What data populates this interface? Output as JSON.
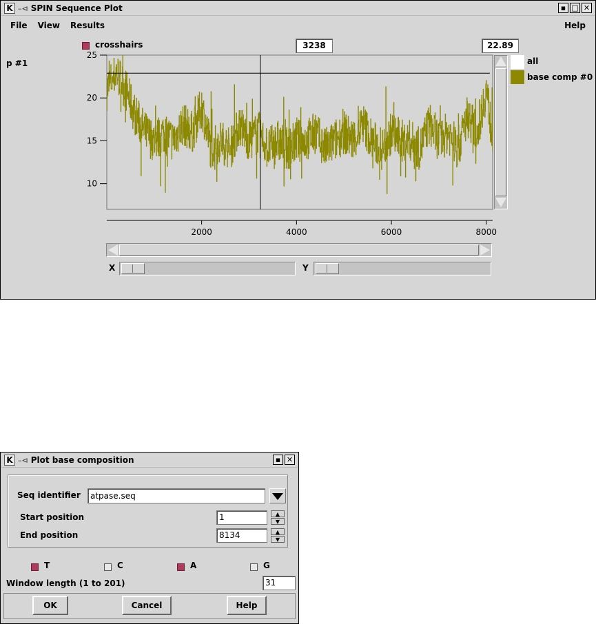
{
  "plot_window": {
    "title": "SPIN Sequence Plot",
    "menus": [
      "File",
      "View",
      "Results"
    ],
    "help_menu": "Help",
    "crosshairs_label": "crosshairs",
    "crosshairs_checked": true,
    "x_readout": "3238",
    "y_readout": "22.89",
    "plot_name": "p #1",
    "legend": [
      {
        "label": "all",
        "color": "#ffffff"
      },
      {
        "label": "base comp #0",
        "color": "#8c8800"
      }
    ],
    "x_zoom_label": "X",
    "y_zoom_label": "Y"
  },
  "chart_data": {
    "type": "line",
    "title": "",
    "xlabel": "",
    "ylabel": "",
    "xlim": [
      1,
      8134
    ],
    "ylim": [
      7,
      25
    ],
    "x_ticks": [
      "2000",
      "4000",
      "6000",
      "8000"
    ],
    "y_ticks": [
      "10",
      "15",
      "20",
      "25"
    ],
    "crosshair": {
      "x": 3238,
      "y": 22.89
    },
    "series": [
      {
        "name": "base comp #0",
        "color": "#8c8800",
        "x": [
          1,
          200,
          400,
          600,
          800,
          1000,
          1200,
          1400,
          1600,
          1800,
          2000,
          2200,
          2400,
          2600,
          2800,
          3000,
          3200,
          3400,
          3600,
          3800,
          4000,
          4200,
          4400,
          4600,
          4800,
          5000,
          5200,
          5400,
          5600,
          5800,
          6000,
          6200,
          6400,
          6600,
          6800,
          7000,
          7200,
          7400,
          7600,
          7800,
          8000,
          8134
        ],
        "values": [
          21,
          23,
          21,
          18,
          16,
          15,
          16,
          15,
          17,
          16,
          19,
          14,
          15,
          14,
          17,
          15,
          16,
          14,
          15,
          14,
          15,
          15,
          16,
          14,
          15,
          16,
          15,
          17,
          15,
          14,
          16,
          15,
          15,
          14,
          17,
          15,
          16,
          14,
          18,
          16,
          21,
          15
        ]
      }
    ]
  },
  "dialog": {
    "title": "Plot base composition",
    "seq_identifier_label": "Seq identifier",
    "seq_identifier_value": "atpase.seq",
    "start_label": "Start position",
    "start_value": "1",
    "end_label": "End position",
    "end_value": "8134",
    "bases": [
      {
        "label": "T",
        "checked": true
      },
      {
        "label": "C",
        "checked": false
      },
      {
        "label": "A",
        "checked": true
      },
      {
        "label": "G",
        "checked": false
      }
    ],
    "window_length_label": "Window length (1 to 201)",
    "window_length_value": "31",
    "ok_label": "OK",
    "cancel_label": "Cancel",
    "help_label": "Help"
  }
}
